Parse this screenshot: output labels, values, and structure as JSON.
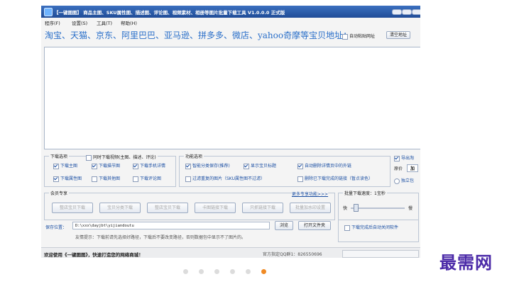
{
  "window": {
    "title": "【一键图图】 商品主图、SKU属性图、描述图、评论图、视频素材、相册等图片批量下载工具 V1.0.0.0 正式版"
  },
  "menu": [
    "程序(F)",
    "设置(S)",
    "工具(T)",
    "帮助(H)"
  ],
  "url_row": {
    "sites_label": "淘宝、天猫、京东、阿里巴巴、亚马逊、拼多多、微店、yahoo奇摩等宝贝地址：",
    "auto_paste": "自动粘贴网址",
    "clear_button": "清空地址"
  },
  "download_options": {
    "legend": "下载选项",
    "video": "同时下载视频(主图、描述、评论)",
    "items": [
      {
        "label": "下载主图",
        "checked": true
      },
      {
        "label": "下载描节图",
        "checked": true
      },
      {
        "label": "下载手机详情",
        "checked": true
      },
      {
        "label": "下载属性图",
        "checked": true
      },
      {
        "label": "下载其他图",
        "checked": false
      },
      {
        "label": "下载评论图",
        "checked": false
      }
    ]
  },
  "features": {
    "legend": "功能选项",
    "items": [
      {
        "label": "智能分类保存(推荐)",
        "checked": true
      },
      {
        "label": "显示宝贝标题",
        "checked": true
      },
      {
        "label": "自动删除详情页中的外链",
        "checked": true
      },
      {
        "label": "过滤重复的图片（SKU属性图不过滤）",
        "checked": false
      },
      {
        "label": "删除已下载完成的链接（暂点读色）",
        "checked": false
      }
    ]
  },
  "right_options": {
    "export": "导出淘",
    "original_label": "原价",
    "original_value": "加",
    "standalone": "独立包"
  },
  "member": {
    "legend": "会员专享",
    "more_link": "更多专享功能>>>",
    "buttons": [
      "整店宝贝下载",
      "宝贝分类下载",
      "整店宝贝下载",
      "卡图链接下载",
      "只抓链接下载",
      "批量加水印设置"
    ]
  },
  "batch": {
    "legend": "批量下载速度：1宝秒",
    "fast": "快",
    "slow": "慢",
    "speed_value": 0.05,
    "auto_shutdown": "下载完成后自动关闭软件"
  },
  "save": {
    "label": "保存位置：",
    "path": "D:\\xxx\\dayjbt\\yijiandoutu",
    "browse": "浏览",
    "open_folder": "打开文件夹"
  },
  "tip": "友情提示：下载前请先选择好路径，下载后不要改变路径，否则数据包中显示不了图片的。",
  "status": {
    "welcome": "欢迎使用《一键图图》，快速打造您的网络商城！",
    "qq": "官方指定QQ群1：826550696"
  },
  "carousel": {
    "count": 6,
    "active": 5
  },
  "watermark": "最需网"
}
